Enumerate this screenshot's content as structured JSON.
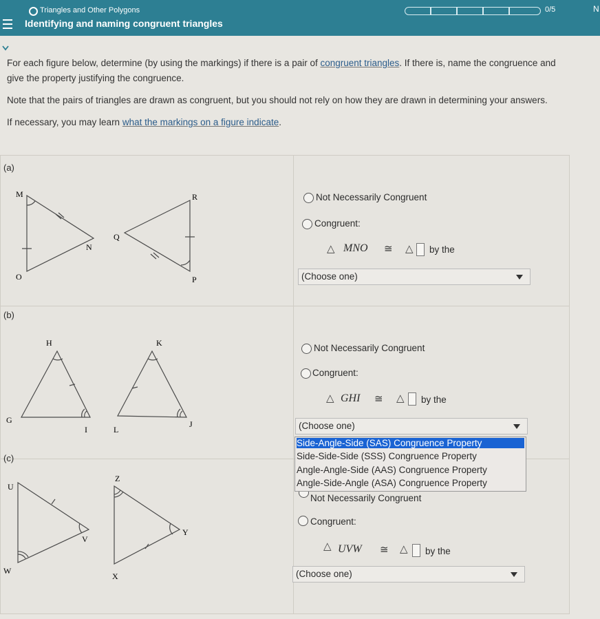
{
  "header": {
    "topic": "Triangles and Other Polygons",
    "subtitle": "Identifying and naming congruent triangles",
    "score": "0/5",
    "corner": "N"
  },
  "instructions": {
    "p1_a": "For each figure below, determine (by using the markings) if there is a pair of ",
    "p1_link": "congruent triangles",
    "p1_b": ". If there is, name the congruence and",
    "p1_c": "give the property justifying the congruence.",
    "p2": "Note that the pairs of triangles are drawn as congruent, but you should not rely on how they are drawn in determining your answers.",
    "p3_a": "If necessary, you may learn ",
    "p3_link": "what the markings on a figure indicate",
    "p3_b": "."
  },
  "parts": [
    {
      "label": "(a)",
      "vertices": {
        "left1": "M",
        "left2": "N",
        "left3": "O",
        "right1": "R",
        "right2": "Q",
        "right3": "P"
      },
      "not_congruent": "Not Necessarily Congruent",
      "congruent": "Congruent:",
      "triangle_name": "MNO",
      "by_the": "by the",
      "select_value": "(Choose one)"
    },
    {
      "label": "(b)",
      "vertices": {
        "left1": "H",
        "left2": "G",
        "left3": "I",
        "right1": "K",
        "right2": "L",
        "right3": "J"
      },
      "not_congruent": "Not Necessarily Congruent",
      "congruent": "Congruent:",
      "triangle_name": "GHI",
      "by_the": "by the",
      "select_value": "(Choose one)"
    },
    {
      "label": "(c)",
      "vertices": {
        "left1": "U",
        "left2": "V",
        "left3": "W",
        "right1": "Z",
        "right2": "Y",
        "right3": "X"
      },
      "not_congruent": "Not Necessarily Congruent",
      "congruent": "Congruent:",
      "triangle_name": "UVW",
      "by_the": "by the",
      "select_value": "(Choose one)"
    }
  ],
  "symbols": {
    "triangle": "△",
    "congruent": "≅"
  },
  "dropdown_options": [
    "Side-Angle-Side (SAS) Congruence Property",
    "Side-Side-Side (SSS) Congruence Property",
    "Angle-Angle-Side (AAS) Congruence Property",
    "Angle-Side-Angle (ASA) Congruence Property"
  ],
  "colors": {
    "header": "#2d7f93",
    "highlight": "#1a63d3",
    "link": "#2b5c8a"
  }
}
